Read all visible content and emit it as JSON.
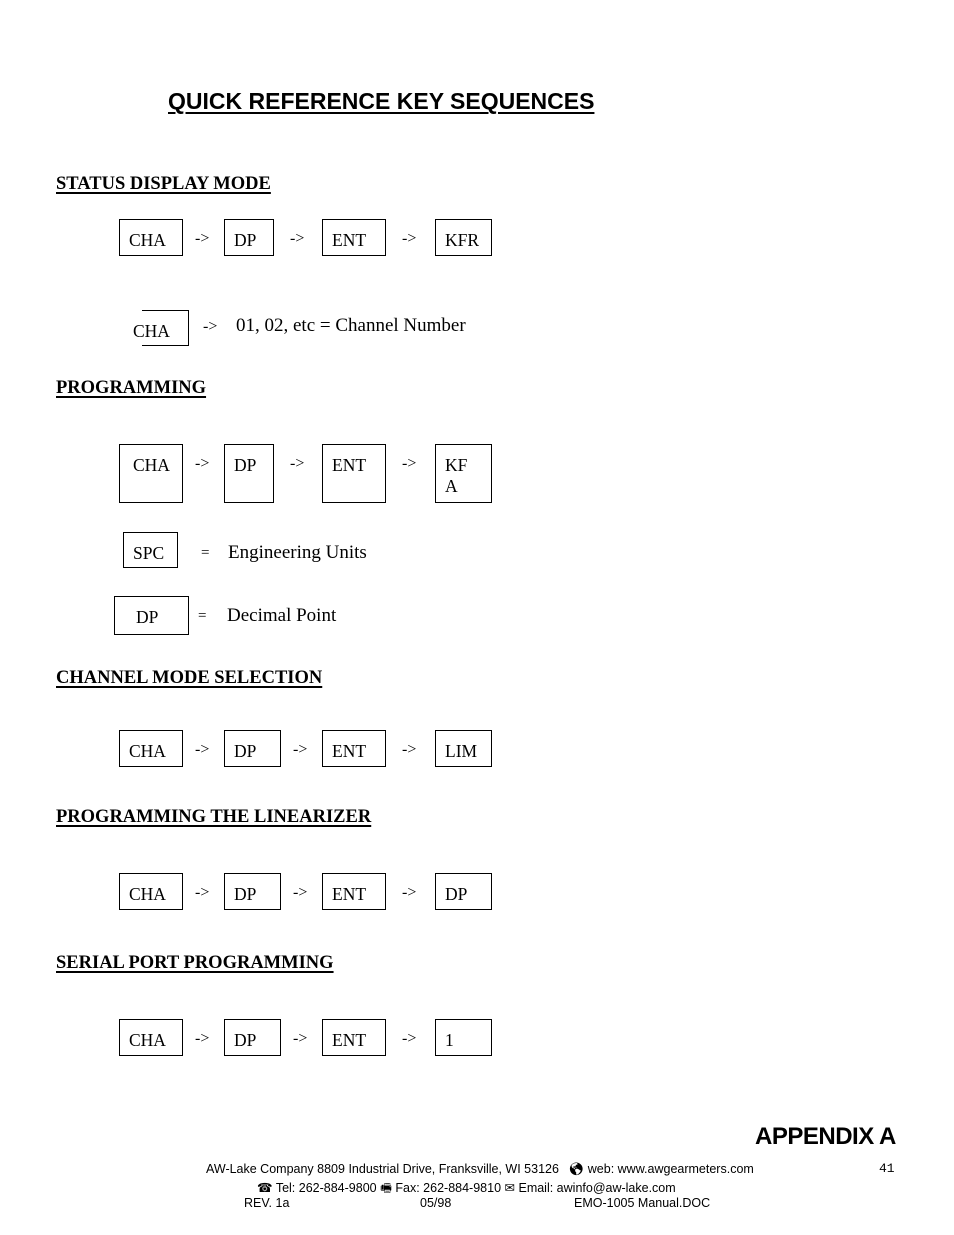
{
  "title": "QUICK REFERENCE KEY SEQUENCES",
  "sections": [
    {
      "heading": "STATUS  DISPLAY MODE",
      "sequence": [
        "CHA",
        "DP",
        "ENT",
        "KFR"
      ],
      "note": {
        "key": "CHA",
        "separator": "->",
        "text": "01, 02, etc = Channel Number"
      }
    },
    {
      "heading": "PROGRAMMING",
      "sequence": [
        "CHA",
        "DP",
        "ENT",
        "KF\nA"
      ],
      "definitions": [
        {
          "key": "SPC",
          "separator": "=",
          "text": "Engineering Units"
        },
        {
          "key": "DP",
          "separator": "=",
          "text": "Decimal Point"
        }
      ]
    },
    {
      "heading": "CHANNEL MODE SELECTION",
      "sequence": [
        "CHA",
        "DP",
        "ENT",
        "LIM"
      ]
    },
    {
      "heading": "PROGRAMMING THE LINEARIZER",
      "sequence": [
        "CHA",
        "DP",
        "ENT",
        "DP"
      ]
    },
    {
      "heading": "SERIAL PORT PROGRAMMING",
      "sequence": [
        "CHA",
        "DP",
        "ENT",
        "1"
      ]
    }
  ],
  "arrow": "->",
  "appendix": "APPENDIX A",
  "page_number": "41",
  "footer": {
    "line1": "AW-Lake Company 8809 Industrial Drive, Franksville, WI 53126",
    "web_icon": "globe-icon",
    "web": "web: www.awgearmeters.com",
    "tel_icon": "telephone-icon",
    "tel": "Tel:  262-884-9800",
    "fax_icon": "fax-icon",
    "fax": "Fax:  262-884-9810",
    "email_icon": "email-icon",
    "email": "Email: awinfo@aw-lake.com",
    "rev": "REV. 1a",
    "date": "05/98",
    "doc": "EMO-1005 Manual.DOC"
  }
}
